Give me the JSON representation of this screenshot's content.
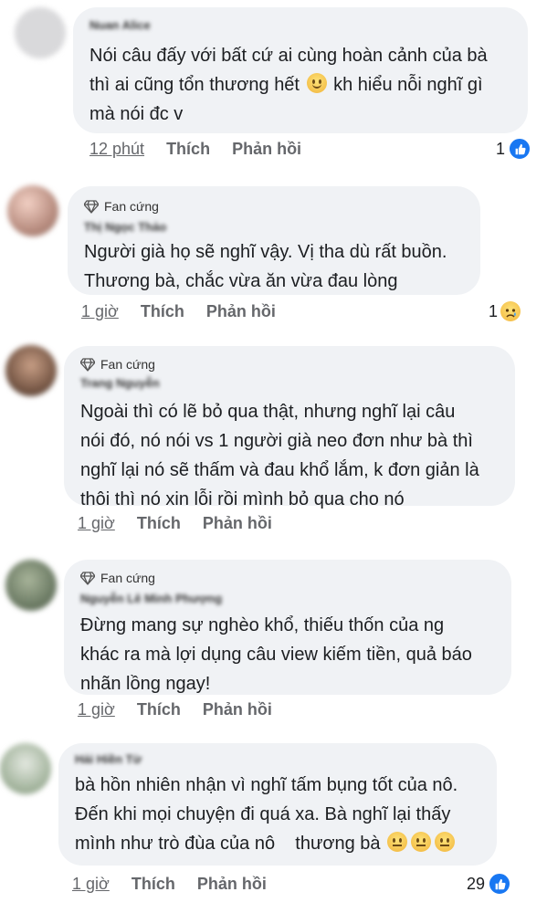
{
  "comments": [
    {
      "name": "Nuan Alice",
      "badge": "",
      "lines": [
        "Nói câu đấy với bất cứ ai cùng hoàn cảnh của bà",
        "thì ai cũng tổn thương hết",
        "kh hiểu nỗi nghĩ gì",
        "mà nói đc v"
      ],
      "time": "12 phút",
      "like": "Thích",
      "reply": "Phản hồi",
      "reaction_count": "1",
      "reaction_icon": "like-icon"
    },
    {
      "name": "Thị Ngọc Thảo",
      "badge": "Fan cứng",
      "lines": [
        "Người già họ sẽ nghĩ vậy. Vị tha dù rất buồn.",
        "Thương bà, chắc vừa ăn vừa đau lòng"
      ],
      "time": "1 giờ",
      "like": "Thích",
      "reply": "Phản hồi",
      "reaction_count": "1",
      "reaction_icon": "sad-icon"
    },
    {
      "name": "Trang Nguyễn",
      "badge": "Fan cứng",
      "lines": [
        "Ngoài thì có lẽ bỏ qua thật, nhưng nghĩ lại câu",
        "nói đó, nó nói vs 1 người già neo đơn như bà thì",
        "nghĩ lại nó sẽ thấm và đau khổ lắm, k đơn giản là",
        "thôi thì nó xin lỗi rồi mình bỏ qua cho nó"
      ],
      "time": "1 giờ",
      "like": "Thích",
      "reply": "Phản hồi",
      "reaction_count": "",
      "reaction_icon": ""
    },
    {
      "name": "Nguyễn Lê Minh Phượng",
      "badge": "Fan cứng",
      "lines": [
        "Đừng mang sự nghèo khổ, thiếu thốn của ng",
        "khác ra mà lợi dụng câu view kiếm tiền, quả báo",
        "nhãn lồng ngay!"
      ],
      "time": "1 giờ",
      "like": "Thích",
      "reply": "Phản hồi",
      "reaction_count": "",
      "reaction_icon": ""
    },
    {
      "name": "Hải Hiền Từ",
      "badge": "",
      "lines": [
        "bà hồn nhiên nhận vì nghĩ tấm bụng tốt của nô.",
        "Đến khi mọi chuyện đi quá xa. Bà nghĩ lại thấy",
        "mình như trò đùa của nô    thương bà"
      ],
      "time": "1 giờ",
      "like": "Thích",
      "reply": "Phản hồi",
      "reaction_count": "29",
      "reaction_icon": "like-icon"
    }
  ],
  "colors": {
    "bubble": "#f0f2f5",
    "meta": "#65676b",
    "like_blue": "#1877f2"
  }
}
